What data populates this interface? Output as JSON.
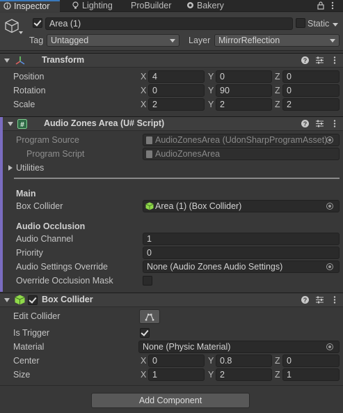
{
  "tabs": [
    {
      "label": "Inspector",
      "active": true
    },
    {
      "label": "Lighting"
    },
    {
      "label": "ProBuilder"
    },
    {
      "label": "Bakery"
    }
  ],
  "object": {
    "name": "Area (1)",
    "static_label": "Static",
    "tag_label": "Tag",
    "tag_value": "Untagged",
    "layer_label": "Layer",
    "layer_value": "MirrorReflection"
  },
  "transform": {
    "title": "Transform",
    "rows": [
      {
        "label": "Position",
        "x": "4",
        "y": "0",
        "z": "0"
      },
      {
        "label": "Rotation",
        "x": "0",
        "y": "90",
        "z": "0"
      },
      {
        "label": "Scale",
        "x": "2",
        "y": "2",
        "z": "2"
      }
    ],
    "axis_x": "X",
    "axis_y": "Y",
    "axis_z": "Z"
  },
  "udon": {
    "title": "Audio Zones Area (U# Script)",
    "program_source_label": "Program Source",
    "program_source_value": "AudioZonesArea (UdonSharpProgramAsset)",
    "program_script_label": "Program Script",
    "program_script_value": "AudioZonesArea",
    "utilities_label": "Utilities",
    "main_header": "Main",
    "box_collider_label": "Box Collider",
    "box_collider_value": "Area (1) (Box Collider)",
    "occlusion_header": "Audio Occlusion",
    "audio_channel_label": "Audio Channel",
    "audio_channel_value": "1",
    "priority_label": "Priority",
    "priority_value": "0",
    "settings_override_label": "Audio Settings Override",
    "settings_override_value": "None (Audio Zones Audio Settings)",
    "override_mask_label": "Override Occlusion Mask"
  },
  "box_collider": {
    "title": "Box Collider",
    "edit_collider_label": "Edit Collider",
    "is_trigger_label": "Is Trigger",
    "material_label": "Material",
    "material_value": "None (Physic Material)",
    "center_label": "Center",
    "center": {
      "x": "0",
      "y": "0.8",
      "z": "0"
    },
    "size_label": "Size",
    "size": {
      "x": "1",
      "y": "2",
      "z": "1"
    }
  },
  "add_component_label": "Add Component",
  "colors": {
    "accent_tab": "#3a79bb",
    "udon_strip": "#7a6cc0"
  }
}
